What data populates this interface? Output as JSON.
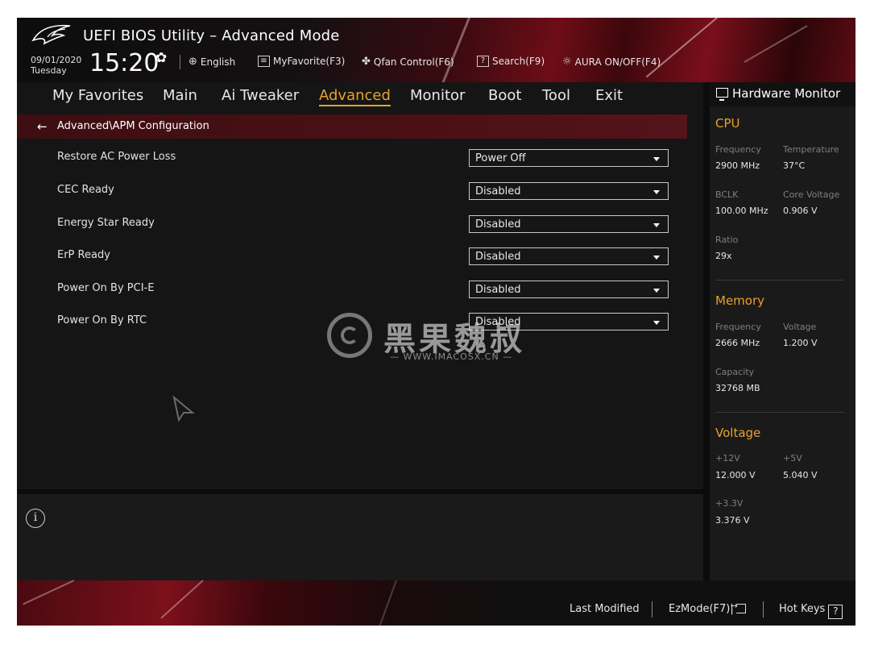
{
  "header": {
    "title": "UEFI BIOS Utility – Advanced Mode",
    "date": "09/01/2020",
    "day": "Tuesday",
    "time": "15:20",
    "items": {
      "language": "English",
      "favorite": "MyFavorite(F3)",
      "qfan": "Qfan Control(F6)",
      "search": "Search(F9)",
      "aura": "AURA ON/OFF(F4)"
    }
  },
  "nav": {
    "tabs": [
      "My Favorites",
      "Main",
      "Ai Tweaker",
      "Advanced",
      "Monitor",
      "Boot",
      "Tool",
      "Exit"
    ],
    "active": "Advanced"
  },
  "breadcrumb": "Advanced\\APM Configuration",
  "settings": [
    {
      "label": "Restore AC Power Loss",
      "value": "Power Off"
    },
    {
      "label": "CEC Ready",
      "value": "Disabled"
    },
    {
      "label": "Energy Star Ready",
      "value": "Disabled"
    },
    {
      "label": "ErP Ready",
      "value": "Disabled"
    },
    {
      "label": "Power On By PCI-E",
      "value": "Disabled"
    },
    {
      "label": "Power On By RTC",
      "value": "Disabled"
    }
  ],
  "watermark": {
    "text": "黑果魏叔",
    "url": "WWW.IMACOSX.CN"
  },
  "hardware_monitor": {
    "title": "Hardware Monitor",
    "cpu": {
      "heading": "CPU",
      "frequency_label": "Frequency",
      "frequency": "2900 MHz",
      "temperature_label": "Temperature",
      "temperature": "37°C",
      "bclk_label": "BCLK",
      "bclk": "100.00 MHz",
      "core_voltage_label": "Core Voltage",
      "core_voltage": "0.906 V",
      "ratio_label": "Ratio",
      "ratio": "29x"
    },
    "memory": {
      "heading": "Memory",
      "frequency_label": "Frequency",
      "frequency": "2666 MHz",
      "voltage_label": "Voltage",
      "voltage": "1.200 V",
      "capacity_label": "Capacity",
      "capacity": "32768 MB"
    },
    "voltage": {
      "heading": "Voltage",
      "v12_label": "+12V",
      "v12": "12.000 V",
      "v5_label": "+5V",
      "v5": "5.040 V",
      "v33_label": "+3.3V",
      "v33": "3.376 V"
    }
  },
  "footer": {
    "last_modified": "Last Modified",
    "ezmode": "EzMode(F7)|",
    "hotkeys": "Hot Keys",
    "help_glyph": "?"
  },
  "colors": {
    "accent": "#e8a22c",
    "breadcrumb_bg": "#4a1014",
    "panel_bg": "#151515"
  }
}
